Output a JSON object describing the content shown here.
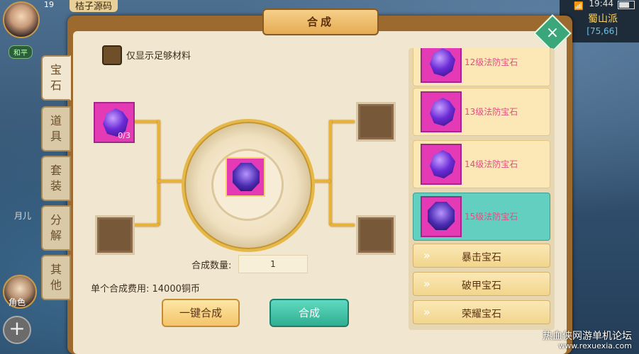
{
  "hud": {
    "player_level": "19",
    "player_name": "桔子源码",
    "status_chip": "和平",
    "clock": "19:44",
    "map_name": "蜀山派",
    "map_coords": "[75,66]",
    "left_label": "月儿",
    "bottom_label": "角色",
    "plus_label": "+"
  },
  "panel": {
    "title": "合成",
    "close_label": "×",
    "tabs": [
      "宝\n石",
      "道\n具",
      "套\n装",
      "分\n解",
      "其\n他"
    ],
    "filter_label": "仅显示足够材料",
    "material_count": "0/3",
    "quantity_label": "合成数量:",
    "quantity_value": "1",
    "fee_label": "单个合成费用: 14000铜币",
    "one_click_label": "一键合成",
    "combine_label": "合成"
  },
  "gem_list": [
    {
      "label": "12级法防宝石",
      "selected": false
    },
    {
      "label": "13级法防宝石",
      "selected": false
    },
    {
      "label": "14级法防宝石",
      "selected": false
    },
    {
      "label": "15级法防宝石",
      "selected": true
    }
  ],
  "categories": [
    "暴击宝石",
    "破甲宝石",
    "荣耀宝石"
  ],
  "watermark": {
    "line1": "热血侠网游单机论坛",
    "line2": "www.rexuexia.com"
  },
  "colors": {
    "panel_frame": "#9c6a2e",
    "panel_fill": "#f1e6cf",
    "gem_slot": "#e43ab6",
    "selected_item": "#62cfc0",
    "combine_button": "#2fae92"
  }
}
